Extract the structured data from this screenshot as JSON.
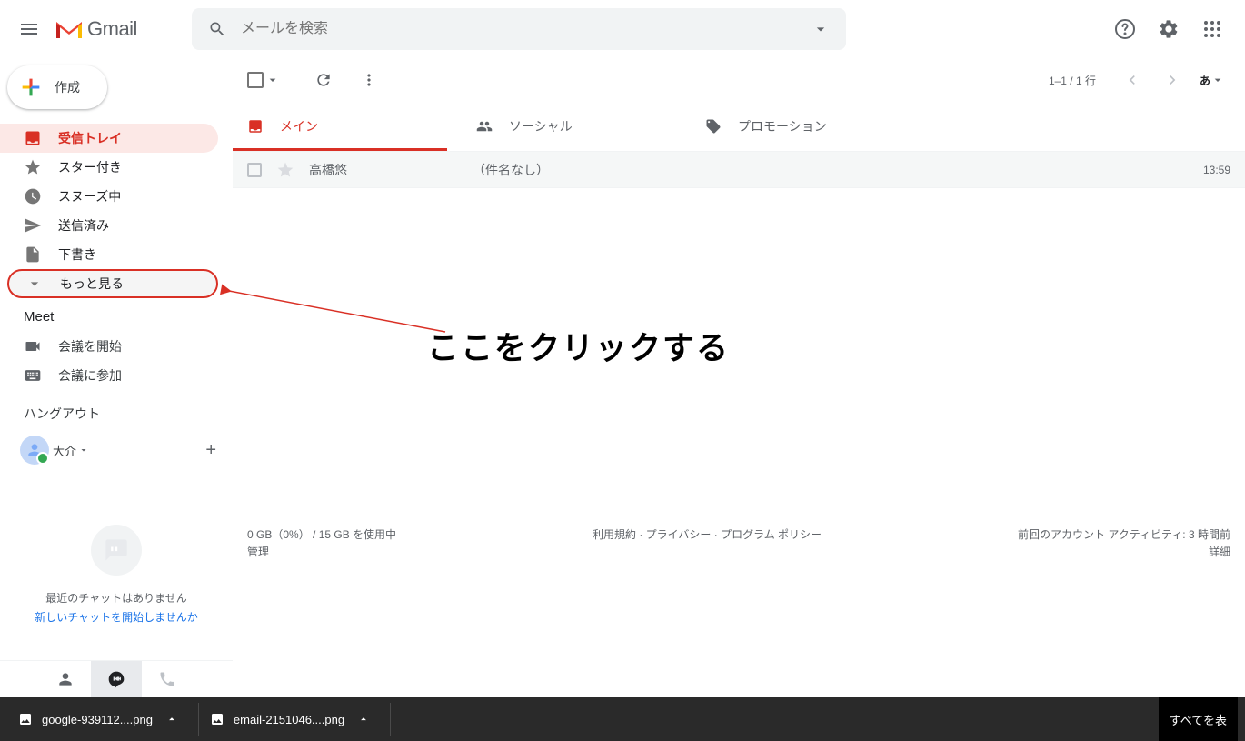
{
  "header": {
    "app_name": "Gmail",
    "search_placeholder": "メールを検索"
  },
  "sidebar": {
    "compose_label": "作成",
    "items": [
      {
        "label": "受信トレイ"
      },
      {
        "label": "スター付き"
      },
      {
        "label": "スヌーズ中"
      },
      {
        "label": "送信済み"
      },
      {
        "label": "下書き"
      },
      {
        "label": "もっと見る"
      }
    ],
    "meet_section": "Meet",
    "meet_items": [
      {
        "label": "会議を開始"
      },
      {
        "label": "会議に参加"
      }
    ],
    "hangouts_section": "ハングアウト",
    "hangouts_user": "大介",
    "hangouts_empty_msg": "最近のチャットはありません",
    "hangouts_link": "新しいチャットを開始しませんか"
  },
  "toolbar": {
    "page_count": "1–1 / 1 行",
    "lang": "あ"
  },
  "tabs": [
    {
      "label": "メイン"
    },
    {
      "label": "ソーシャル"
    },
    {
      "label": "プロモーション"
    }
  ],
  "mail": {
    "sender": "高橋悠",
    "subject": "（件名なし）",
    "time": "13:59"
  },
  "annotation": "ここをクリックする",
  "footer": {
    "storage_line1": "0 GB（0%） / 15 GB を使用中",
    "storage_line2": "管理",
    "center": "利用規約 · プライバシー · プログラム ポリシー",
    "activity_line1": "前回のアカウント アクティビティ: 3 時間前",
    "activity_line2": "詳細"
  },
  "downloads": [
    {
      "name": "google-939112....png"
    },
    {
      "name": "email-2151046....png"
    }
  ],
  "show_all": "すべてを表"
}
